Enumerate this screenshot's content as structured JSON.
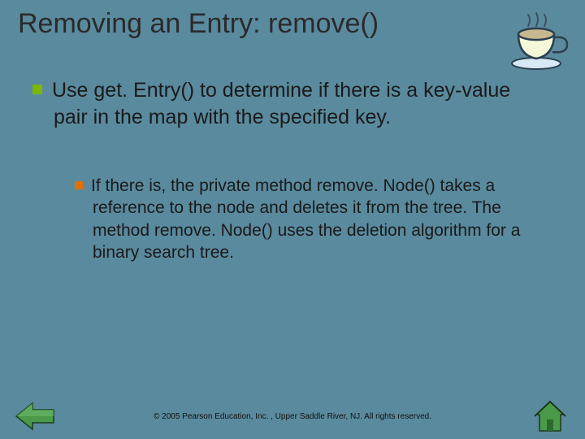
{
  "title": "Removing an Entry: remove()",
  "bullet_main": "Use get. Entry() to determine if there is a key‑value pair in the map with the specified key.",
  "bullet_sub": "If there is, the private method remove. Node() takes a reference to the node and deletes it from the tree. The method remove. Node() uses the deletion algorithm for a binary search tree.",
  "footer": "© 2005 Pearson Education, Inc. , Upper Saddle River, NJ.  All rights reserved.",
  "icons": {
    "corner": "teacup-icon",
    "nav_back": "back-arrow-icon",
    "nav_home": "home-icon"
  },
  "colors": {
    "background": "#5a8a9e",
    "bullet_primary": "#7ab800",
    "bullet_secondary": "#e07000",
    "nav_green": "#4a9a4a",
    "nav_green_dark": "#2a6a2a"
  }
}
